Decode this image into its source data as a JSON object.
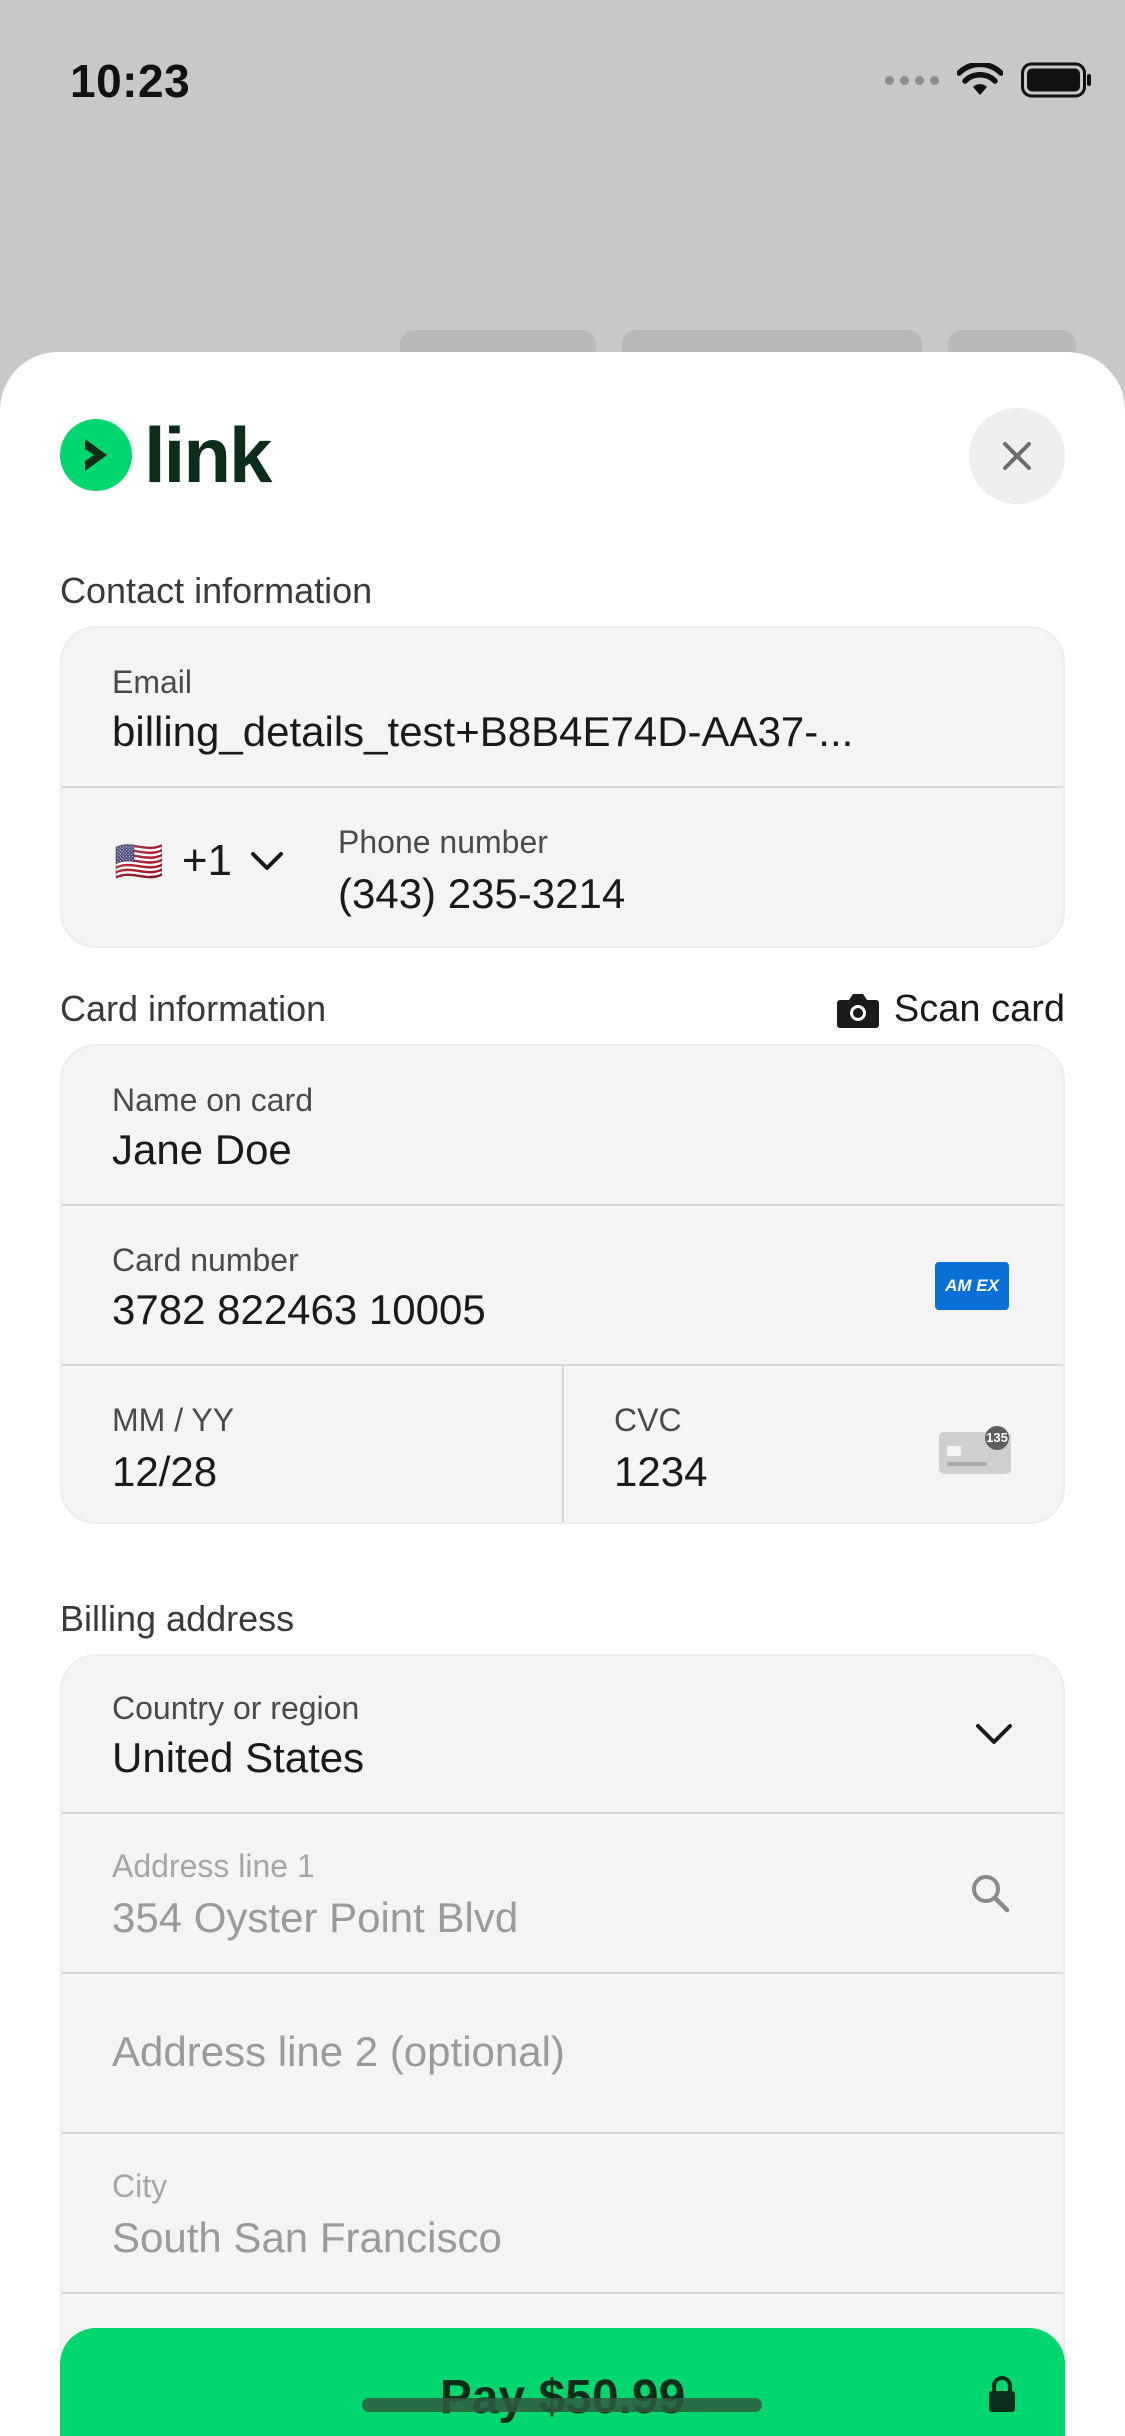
{
  "status_bar": {
    "time": "10:23"
  },
  "header": {
    "logo_text": "link",
    "close_icon": "close-icon"
  },
  "contact": {
    "section_label": "Contact information",
    "email_label": "Email",
    "email_value": "billing_details_test+B8B4E74D-AA37-...",
    "country_flag": "🇺🇸",
    "country_code": "+1",
    "phone_label": "Phone number",
    "phone_value": "(343) 235-3214"
  },
  "card": {
    "section_label": "Card information",
    "scan_label": "Scan card",
    "name_label": "Name on card",
    "name_value": "Jane Doe",
    "number_label": "Card number",
    "number_value": "3782 822463 10005",
    "brand_text": "AM EX",
    "expiry_label": "MM / YY",
    "expiry_value": "12/28",
    "cvc_label": "CVC",
    "cvc_value": "1234",
    "cvc_badge": "135"
  },
  "billing": {
    "section_label": "Billing address",
    "country_label": "Country or region",
    "country_value": "United States",
    "address1_label": "Address line 1",
    "address1_value": "354 Oyster Point Blvd",
    "address2_placeholder": "Address line 2 (optional)",
    "city_label": "City",
    "city_value": "South San Francisco"
  },
  "footer": {
    "pay_label": "Pay $50.99"
  },
  "colors": {
    "brand_green": "#00d66f",
    "amex_blue": "#0b6fd8"
  }
}
